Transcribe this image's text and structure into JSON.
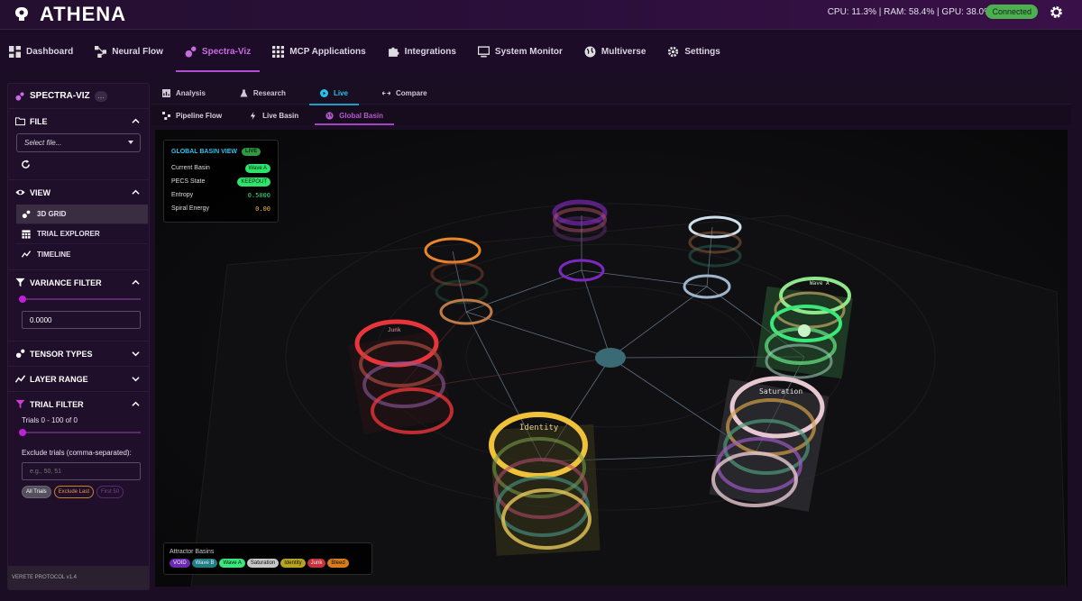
{
  "app": {
    "title": "ATHENA",
    "stats": "CPU: 11.3% | RAM: 58.4% | GPU: 38.0%",
    "status": "Connected"
  },
  "nav": {
    "items": [
      {
        "label": "Dashboard",
        "icon": "dashboard-icon"
      },
      {
        "label": "Neural Flow",
        "icon": "network-icon"
      },
      {
        "label": "Spectra-Viz",
        "icon": "bubbles-icon"
      },
      {
        "label": "MCP Applications",
        "icon": "apps-grid-icon"
      },
      {
        "label": "Integrations",
        "icon": "puzzle-icon"
      },
      {
        "label": "System Monitor",
        "icon": "monitor-icon"
      },
      {
        "label": "Multiverse",
        "icon": "globe-icon"
      },
      {
        "label": "Settings",
        "icon": "gear-icon"
      }
    ],
    "active": "Spectra-Viz"
  },
  "sidebar": {
    "title": "SPECTRA-VIZ",
    "title_badge": "...",
    "file": {
      "heading": "FILE",
      "select_placeholder": "Select file..."
    },
    "view": {
      "heading": "VIEW",
      "items": [
        "3D GRID",
        "TRIAL EXPLORER",
        "TIMELINE"
      ],
      "active": "3D GRID"
    },
    "variance": {
      "heading": "VARIANCE FILTER",
      "value": "0.0000",
      "slider_level": 0
    },
    "tensor_types": {
      "heading": "TENSOR TYPES"
    },
    "layer_range": {
      "heading": "LAYER RANGE"
    },
    "trial_filter": {
      "heading": "TRIAL FILTER",
      "range_label": "Trials 0 - 100 of 0",
      "exclude_label": "Exclude trials (comma-separated):",
      "exclude_placeholder": "e.g., 50, 51",
      "buttons": [
        "All Trials",
        "Exclude Last",
        "First 50"
      ]
    },
    "footer": "VERETE PROTOCOL v1.4"
  },
  "tabs": {
    "primary": [
      "Analysis",
      "Research",
      "Live",
      "Compare"
    ],
    "primary_active": "Live",
    "secondary": [
      "Pipeline Flow",
      "Live Basin",
      "Global Basin"
    ],
    "secondary_active": "Global Basin"
  },
  "info_panel": {
    "title": "GLOBAL BASIN VIEW",
    "live": "LIVE",
    "rows": {
      "current_basin_label": "Current Basin",
      "current_basin_value": "Wave A",
      "pecs_label": "PECS State",
      "pecs_value": "KEEPOUT",
      "entropy_label": "Entropy",
      "entropy_value": "0.5000",
      "spiral_label": "Spiral Energy",
      "spiral_value": "0.00"
    }
  },
  "scene_labels": {
    "identity": "Identity",
    "saturation": "Saturation",
    "junk": "Junk",
    "wave_a": "Wave A"
  },
  "legend": {
    "title": "Attractor Basins",
    "items": [
      {
        "label": "VOID",
        "color": "#6a2bb0"
      },
      {
        "label": "Wave B",
        "color": "#1e7f86"
      },
      {
        "label": "Wave A",
        "color": "#3ae87a"
      },
      {
        "label": "Saturation",
        "color": "#c9c9c9"
      },
      {
        "label": "Identity",
        "color": "#b9a422"
      },
      {
        "label": "Junk",
        "color": "#c8323a"
      },
      {
        "label": "Bleed",
        "color": "#d67c1e"
      }
    ]
  }
}
